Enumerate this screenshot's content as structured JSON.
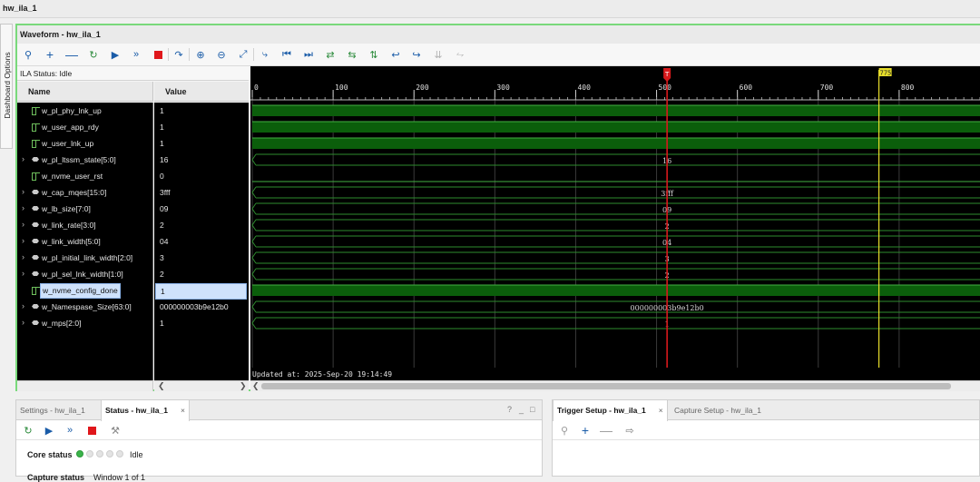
{
  "window_title": "hw_ila_1",
  "side_tab": "Dashboard Options",
  "waveform": {
    "title": "Waveform - hw_ila_1",
    "ila_status": "ILA Status:  Idle",
    "columns": {
      "name": "Name",
      "value": "Value"
    },
    "signals": [
      {
        "name": "w_pl_phy_lnk_up",
        "value": "1",
        "kind": "bit",
        "expandable": false,
        "selected": false
      },
      {
        "name": "w_user_app_rdy",
        "value": "1",
        "kind": "bit",
        "expandable": false,
        "selected": false
      },
      {
        "name": "w_user_lnk_up",
        "value": "1",
        "kind": "bit",
        "expandable": false,
        "selected": false
      },
      {
        "name": "w_pl_ltssm_state[5:0]",
        "value": "16",
        "kind": "bus",
        "expandable": true,
        "selected": false
      },
      {
        "name": "w_nvme_user_rst",
        "value": "0",
        "kind": "bit",
        "expandable": false,
        "selected": false
      },
      {
        "name": "w_cap_mqes[15:0]",
        "value": "3fff",
        "kind": "bus",
        "expandable": true,
        "selected": false
      },
      {
        "name": "w_lb_size[7:0]",
        "value": "09",
        "kind": "bus",
        "expandable": true,
        "selected": false
      },
      {
        "name": "w_link_rate[3:0]",
        "value": "2",
        "kind": "bus",
        "expandable": true,
        "selected": false
      },
      {
        "name": "w_link_width[5:0]",
        "value": "04",
        "kind": "bus",
        "expandable": true,
        "selected": false
      },
      {
        "name": "w_pl_initial_link_width[2:0]",
        "value": "3",
        "kind": "bus",
        "expandable": true,
        "selected": false
      },
      {
        "name": "w_pl_sel_lnk_width[1:0]",
        "value": "2",
        "kind": "bus",
        "expandable": true,
        "selected": false
      },
      {
        "name": "w_nvme_config_done",
        "value": "1",
        "kind": "bit",
        "expandable": false,
        "selected": true
      },
      {
        "name": "w_Namespase_Size[63:0]",
        "value": "000000003b9e12b0",
        "kind": "bus",
        "expandable": true,
        "selected": false
      },
      {
        "name": "w_mps[2:0]",
        "value": "1",
        "kind": "bus",
        "expandable": true,
        "selected": false
      }
    ],
    "trace_values": [
      "",
      "",
      "",
      "16",
      "",
      "3fff",
      "09",
      "2",
      "04",
      "3",
      "2",
      "",
      "000000003b9e12b0",
      "1"
    ],
    "ruler": {
      "ticks": [
        "0",
        "100",
        "200",
        "300",
        "400",
        "500",
        "600",
        "700",
        "800"
      ],
      "range": [
        0,
        900
      ]
    },
    "trigger_marker": {
      "label": "T",
      "sample": 513,
      "color": "#d7191c"
    },
    "cursor_marker": {
      "label": "775",
      "sample": 775,
      "color": "#e6dd2a"
    },
    "updated_at": "Updated at: 2025-Sep-20 19:14:49",
    "colors": {
      "high": "#0b5e0b",
      "edge": "#43b043",
      "bus_outline": "#2e8b2e",
      "bus_text": "#d8d8d8",
      "bg": "#000000"
    }
  },
  "bottom_left": {
    "tabs": [
      "Settings - hw_ila_1",
      "Status - hw_ila_1"
    ],
    "active_tab": "Status - hw_ila_1",
    "close": "×",
    "panel_icons": [
      "?",
      "_",
      "□"
    ],
    "core_status_label": "Core status",
    "core_status_value": "Idle",
    "capture_status_label": "Capture status",
    "capture_status_value": "Window 1 of 1"
  },
  "bottom_right": {
    "tabs": [
      "Trigger Setup - hw_ila_1",
      "Capture Setup - hw_ila_1"
    ],
    "active_tab": "Trigger Setup - hw_ila_1",
    "close": "×"
  }
}
